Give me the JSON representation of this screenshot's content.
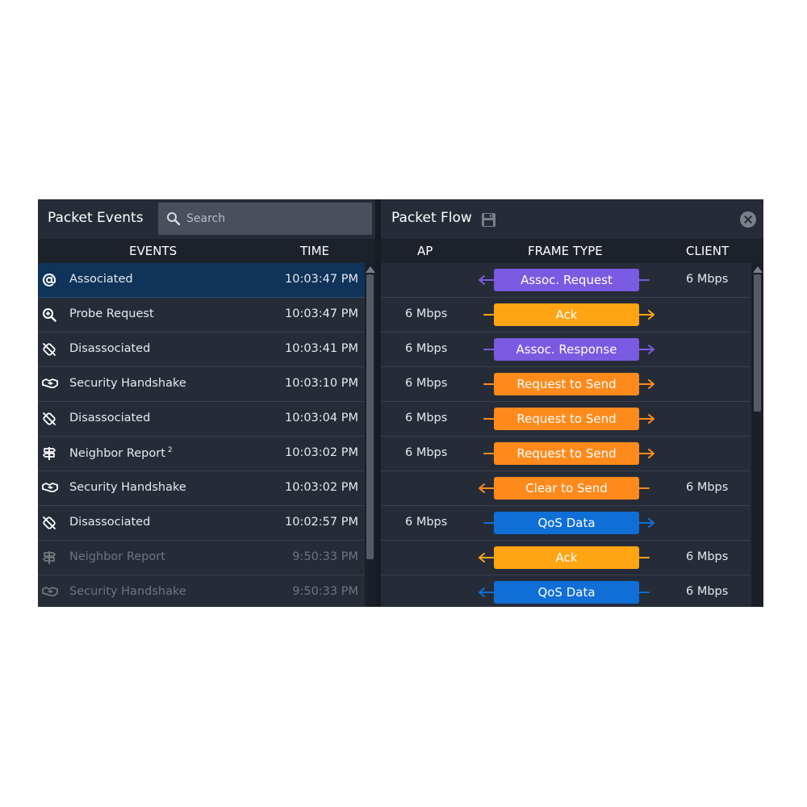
{
  "events_panel": {
    "title": "Packet Events",
    "search_placeholder": "Search",
    "col_events": "EVENTS",
    "col_time": "TIME",
    "rows": [
      {
        "icon": "at-icon",
        "name": "Associated",
        "sup": "",
        "time": "10:03:47 PM",
        "selected": true,
        "dim": false
      },
      {
        "icon": "zoom-in-icon",
        "name": "Probe Request",
        "sup": "",
        "time": "10:03:47 PM",
        "selected": false,
        "dim": false
      },
      {
        "icon": "broken-link-icon",
        "name": "Disassociated",
        "sup": "",
        "time": "10:03:41 PM",
        "selected": false,
        "dim": false
      },
      {
        "icon": "handshake-icon",
        "name": "Security Handshake",
        "sup": "",
        "time": "10:03:10 PM",
        "selected": false,
        "dim": false
      },
      {
        "icon": "broken-link-icon",
        "name": "Disassociated",
        "sup": "",
        "time": "10:03:04 PM",
        "selected": false,
        "dim": false
      },
      {
        "icon": "signpost-icon",
        "name": "Neighbor Report",
        "sup": "2",
        "time": "10:03:02 PM",
        "selected": false,
        "dim": false
      },
      {
        "icon": "handshake-icon",
        "name": "Security Handshake",
        "sup": "",
        "time": "10:03:02 PM",
        "selected": false,
        "dim": false
      },
      {
        "icon": "broken-link-icon",
        "name": "Disassociated",
        "sup": "",
        "time": "10:02:57 PM",
        "selected": false,
        "dim": false
      },
      {
        "icon": "signpost-icon",
        "name": "Neighbor Report",
        "sup": "",
        "time": "9:50:33 PM",
        "selected": false,
        "dim": true
      },
      {
        "icon": "handshake-icon",
        "name": "Security Handshake",
        "sup": "",
        "time": "9:50:33 PM",
        "selected": false,
        "dim": true
      }
    ]
  },
  "flow_panel": {
    "title": "Packet Flow",
    "col_ap": "AP",
    "col_frame": "FRAME TYPE",
    "col_client": "CLIENT",
    "rows": [
      {
        "ap": "",
        "frame": "Assoc. Request",
        "client": "6 Mbps",
        "direction": "to-ap",
        "color": "#7a5ae0"
      },
      {
        "ap": "6 Mbps",
        "frame": "Ack",
        "client": "",
        "direction": "to-client",
        "color": "#ffa514"
      },
      {
        "ap": "6 Mbps",
        "frame": "Assoc. Response",
        "client": "",
        "direction": "to-client",
        "color": "#7a5ae0"
      },
      {
        "ap": "6 Mbps",
        "frame": "Request to Send",
        "client": "",
        "direction": "to-client",
        "color": "#ff8a1c"
      },
      {
        "ap": "6 Mbps",
        "frame": "Request to Send",
        "client": "",
        "direction": "to-client",
        "color": "#ff8a1c"
      },
      {
        "ap": "6 Mbps",
        "frame": "Request to Send",
        "client": "",
        "direction": "to-client",
        "color": "#ff8a1c"
      },
      {
        "ap": "",
        "frame": "Clear to Send",
        "client": "6 Mbps",
        "direction": "to-ap",
        "color": "#ff8a1c"
      },
      {
        "ap": "6 Mbps",
        "frame": "QoS Data",
        "client": "",
        "direction": "to-client",
        "color": "#0f6fd6"
      },
      {
        "ap": "",
        "frame": "Ack",
        "client": "6 Mbps",
        "direction": "to-ap",
        "color": "#ffa514"
      },
      {
        "ap": "",
        "frame": "QoS Data",
        "client": "6 Mbps",
        "direction": "to-ap",
        "color": "#0f6fd6"
      }
    ]
  }
}
